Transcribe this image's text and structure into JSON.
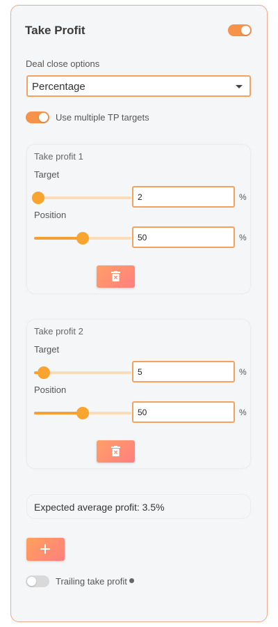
{
  "header": {
    "title": "Take Profit",
    "enabled": true
  },
  "deal_close": {
    "label": "Deal close options",
    "selected": "Percentage"
  },
  "multi_tp": {
    "label": "Use multiple TP targets",
    "enabled": true
  },
  "targets": [
    {
      "title": "Take profit 1",
      "target_label": "Target",
      "target_value": "2",
      "target_unit": "%",
      "position_label": "Position",
      "position_value": "50",
      "position_unit": "%",
      "target_slider_fraction": 0.04,
      "position_slider_fraction": 0.5
    },
    {
      "title": "Take profit 2",
      "target_label": "Target",
      "target_value": "5",
      "target_unit": "%",
      "position_label": "Position",
      "position_value": "50",
      "position_unit": "%",
      "target_slider_fraction": 0.1,
      "position_slider_fraction": 0.5
    }
  ],
  "summary": {
    "text": "Expected average profit: 3.5%"
  },
  "trailing": {
    "label": "Trailing take profit",
    "enabled": false
  },
  "icons": {
    "delete": "trash-icon",
    "add": "plus-icon",
    "info": "info-icon"
  },
  "colors": {
    "accent": "#f7924a",
    "border": "#f2a98a",
    "slider": "#f9a431"
  }
}
